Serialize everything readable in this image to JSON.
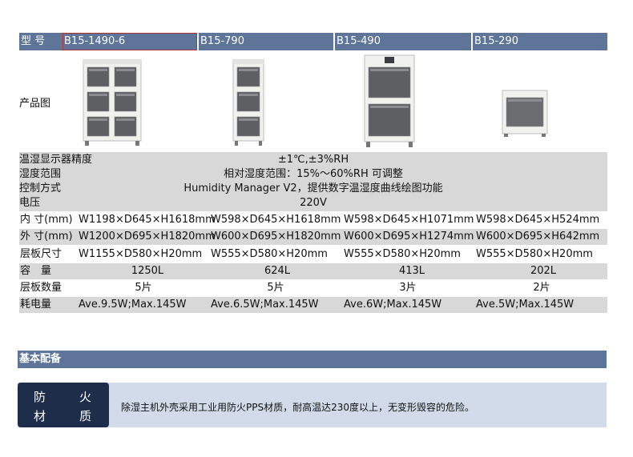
{
  "models": {
    "label": "型 号",
    "items": [
      "B15-1490-6",
      "B15-790",
      "B15-490",
      "B15-290"
    ]
  },
  "image_row": {
    "label": "产品图"
  },
  "specs": [
    {
      "label": "温湿显示器精度",
      "value": "±1℃,±3%RH"
    },
    {
      "label": "湿度范围",
      "value": "相对湿度范围：15%～60%RH 可调整"
    },
    {
      "label": "控制方式",
      "value": "Humidity Manager V2，提供数字温湿度曲线绘图功能"
    },
    {
      "label": "电压",
      "value": "220V"
    }
  ],
  "rows": [
    {
      "label": "内 寸(mm)",
      "values": [
        "W1198×D645×H1618mm",
        "W598×D645×H1618mm",
        "W598×D645×H1071mm",
        "W598×D645×H524mm"
      ]
    },
    {
      "label": "外 寸(mm)",
      "values": [
        "W1200×D695×H1820mm",
        "W600×D695×H1820mm",
        "W600×D695×H1274mm",
        "W600×D695×H642mm"
      ]
    },
    {
      "label": "层板尺寸",
      "values": [
        "W1155×D580×H20mm",
        "W555×D580×H20mm",
        "W555×D580×H20mm",
        "W555×D580×H20mm"
      ]
    },
    {
      "label": "容　量",
      "values": [
        "1250L",
        "624L",
        "413L",
        "202L"
      ]
    },
    {
      "label": "层板数量",
      "values": [
        "5片",
        "5片",
        "3片",
        "2片"
      ]
    },
    {
      "label": "耗电量",
      "values": [
        "Ave.9.5W;Max.145W",
        "Ave.6.5W;Max.145W",
        "Ave.6W;Max.145W",
        "Ave.5W;Max.145W"
      ]
    }
  ],
  "section": {
    "title": "基本配备"
  },
  "fire": {
    "chars": [
      "防",
      "火",
      "材",
      "质"
    ],
    "description": "除湿主机外壳采用工业用防火PPS材质，耐高温达230度以上，无变形毁容的危险。"
  },
  "colors": {
    "header_bar": "#5e7599",
    "row_grey": "#d8d8d8",
    "fire_box": "#1e2d4a",
    "fire_bg": "#d2dbe9",
    "selected_outline": "#b3333b"
  }
}
